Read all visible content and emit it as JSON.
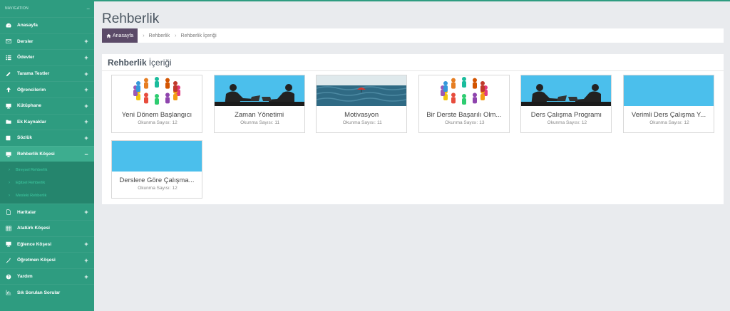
{
  "sidebar": {
    "header": "NAVIGATION",
    "collapse_glyph": "–",
    "items": [
      {
        "label": "Anasayfa",
        "icon": "dashboard-icon",
        "plus": ""
      },
      {
        "label": "Dersler",
        "icon": "envelope-icon",
        "plus": "+"
      },
      {
        "label": "Ödevler",
        "icon": "list-icon",
        "plus": "+"
      },
      {
        "label": "Tarama Testler",
        "icon": "pencil-icon",
        "plus": "+"
      },
      {
        "label": "Öğrencilerim",
        "icon": "arrow-up-icon",
        "plus": "+"
      },
      {
        "label": "Kütüphane",
        "icon": "monitor-icon",
        "plus": "+"
      },
      {
        "label": "Ek Kaynaklar",
        "icon": "folder-icon",
        "plus": "+"
      },
      {
        "label": "Sözlük",
        "icon": "book-icon",
        "plus": "+"
      },
      {
        "label": "Rehberlik Köşesi",
        "icon": "monitor-icon",
        "plus": "−"
      }
    ],
    "subitems": [
      "Bireysel Rehberlik",
      "Eğitsel Rehberlik",
      "Mesleki Rehberlik"
    ],
    "items_after": [
      {
        "label": "Haritalar",
        "icon": "file-icon",
        "plus": "+"
      },
      {
        "label": "Atatürk Köşesi",
        "icon": "table-icon",
        "plus": ""
      },
      {
        "label": "Eğlence Köşesi",
        "icon": "monitor-icon",
        "plus": "+"
      },
      {
        "label": "Öğretmen Köşesi",
        "icon": "wand-icon",
        "plus": "+"
      },
      {
        "label": "Yardım",
        "icon": "help-icon",
        "plus": "+"
      },
      {
        "label": "Sık Sorulan Sorular",
        "icon": "chart-icon",
        "plus": ""
      }
    ]
  },
  "page": {
    "title": "Rehberlik"
  },
  "breadcrumb": {
    "home": "Anasayfa",
    "items": [
      "Rehberlik",
      "Rehberlik İçeriği"
    ]
  },
  "panel": {
    "title_bold": "Rehberlik",
    "title_rest": "İçeriği"
  },
  "cards": [
    {
      "title": "Yeni Dönem Başlangıcı",
      "count_label": "Okunma Sayısı:",
      "count": "12",
      "image": "people-circle"
    },
    {
      "title": "Zaman Yönetimi",
      "count_label": "Okunma Sayısı:",
      "count": "11",
      "image": "silhouettes"
    },
    {
      "title": "Motivasyon",
      "count_label": "Okunma Sayısı:",
      "count": "11",
      "image": "umbrella-sea"
    },
    {
      "title": "Bir Derste Başarılı Olm...",
      "count_label": "Okunma Sayısı:",
      "count": "13",
      "image": "people-circle"
    },
    {
      "title": "Ders Çalışma Programı",
      "count_label": "Okunma Sayısı:",
      "count": "12",
      "image": "silhouettes"
    },
    {
      "title": "Verimli Ders Çalışma Y...",
      "count_label": "Okunma Sayısı:",
      "count": "12",
      "image": "blue-blank"
    },
    {
      "title": "Derslere Göre Çalışma...",
      "count_label": "Okunma Sayısı:",
      "count": "12",
      "image": "blue-blank"
    }
  ],
  "colors": {
    "sidebar": "#2e9c80",
    "sidebar_active": "#3dad8f",
    "breadcrumb_home": "#5b4a68",
    "card_blue": "#4bbfec"
  }
}
